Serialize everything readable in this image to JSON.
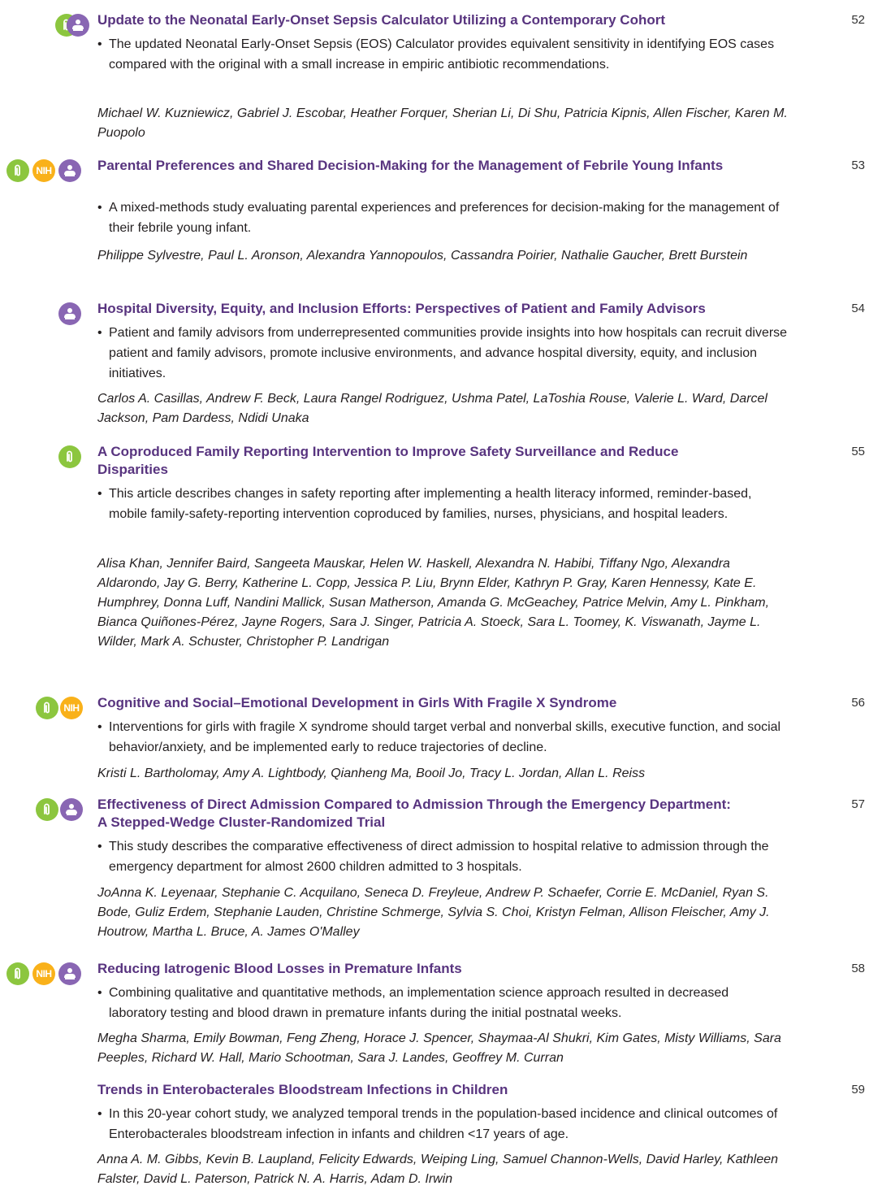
{
  "colors": {
    "title": "#58347f",
    "open_access_icon": "#8cc63f",
    "nih_icon": "#f9b11a",
    "family_icon": "#8966b3"
  },
  "entries": [
    {
      "icons": [
        "open-access",
        "family"
      ],
      "title": "Update to the Neonatal Early-Onset Sepsis Calculator Utilizing a Contemporary Cohort",
      "page": "52",
      "summary": "The updated Neonatal Early-Onset Sepsis (EOS) Calculator provides equivalent sensitivity in identifying EOS cases compared with the original with a small increase in empiric antibiotic recommendations.",
      "authors": "Michael W. Kuzniewicz, Gabriel J. Escobar, Heather Forquer, Sherian Li, Di Shu, Patricia Kipnis, Allen Fischer, Karen M. Puopolo"
    },
    {
      "icons": [
        "open-access",
        "nih",
        "family"
      ],
      "title": "Parental Preferences and Shared Decision-Making for the Management of Febrile Young Infants",
      "page": "53",
      "summary": "A mixed-methods study evaluating parental experiences and preferences for decision-making for the management of their febrile young infant.",
      "authors": "Philippe Sylvestre, Paul L. Aronson, Alexandra Yannopoulos, Cassandra Poirier, Nathalie Gaucher, Brett Burstein"
    },
    {
      "icons": [
        "family"
      ],
      "title": "Hospital Diversity, Equity, and Inclusion Efforts: Perspectives of Patient and Family Advisors",
      "page": "54",
      "summary": "Patient and family advisors from underrepresented communities provide insights into how hospitals can recruit diverse patient and family advisors, promote inclusive environments, and advance hospital diversity, equity, and inclusion initiatives.",
      "authors": "Carlos A. Casillas, Andrew F. Beck, Laura Rangel Rodriguez, Ushma Patel, LaToshia Rouse, Valerie L. Ward, Darcel Jackson, Pam Dardess, Ndidi Unaka"
    },
    {
      "icons": [
        "open-access"
      ],
      "title": "A Coproduced Family Reporting Intervention to Improve Safety Surveillance and Reduce Disparities",
      "page": "55",
      "summary": "This article describes changes in safety reporting after implementing a health literacy informed, reminder-based, mobile family-safety-reporting intervention coproduced by families, nurses, physicians, and hospital leaders.",
      "authors": "Alisa Khan, Jennifer Baird, Sangeeta Mauskar, Helen W. Haskell, Alexandra N. Habibi, Tiffany Ngo, Alexandra Aldarondo, Jay G. Berry, Katherine L. Copp, Jessica P. Liu, Brynn Elder, Kathryn P. Gray, Karen Hennessy, Kate E. Humphrey, Donna Luff, Nandini Mallick, Susan Matherson, Amanda G. McGeachey, Patrice Melvin, Amy L. Pinkham, Bianca Quiñones-Pérez, Jayne Rogers, Sara J. Singer, Patricia A. Stoeck, Sara L. Toomey, K. Viswanath, Jayme L. Wilder, Mark A. Schuster, Christopher P. Landrigan"
    },
    {
      "icons": [
        "open-access",
        "nih"
      ],
      "title": "Cognitive and Social–Emotional Development in Girls With Fragile X Syndrome",
      "page": "56",
      "summary": "Interventions for girls with fragile X syndrome should target verbal and nonverbal skills, executive function, and social behavior/anxiety, and be implemented early to reduce trajectories of decline.",
      "authors": "Kristi L. Bartholomay, Amy A. Lightbody, Qianheng Ma, Booil Jo, Tracy L. Jordan, Allan L. Reiss"
    },
    {
      "icons": [
        "open-access",
        "family"
      ],
      "title": "Effectiveness of Direct Admission Compared to Admission Through the Emergency Department: A Stepped-Wedge Cluster-Randomized Trial",
      "page": "57",
      "summary": "This study describes the comparative effectiveness of direct admission to hospital relative to admission through the emergency department for almost 2600 children admitted to 3 hospitals.",
      "authors": "JoAnna K. Leyenaar, Stephanie C. Acquilano, Seneca D. Freyleue, Andrew P. Schaefer, Corrie E. McDaniel, Ryan S. Bode, Guliz Erdem, Stephanie Lauden, Christine Schmerge, Sylvia S. Choi, Kristyn Felman, Allison Fleischer, Amy J. Houtrow, Martha L. Bruce, A. James O'Malley"
    },
    {
      "icons": [
        "open-access",
        "nih",
        "family"
      ],
      "title": "Reducing Iatrogenic Blood Losses in Premature Infants",
      "page": "58",
      "summary": "Combining qualitative and quantitative methods, an implementation science approach resulted in decreased laboratory testing and blood drawn in premature infants during the initial postnatal weeks.",
      "authors": "Megha Sharma, Emily Bowman, Feng Zheng, Horace J. Spencer, Shaymaa-Al Shukri, Kim Gates, Misty Williams, Sara Peeples, Richard W. Hall, Mario Schootman, Sara J. Landes, Geoffrey M. Curran"
    },
    {
      "icons": [],
      "title": "Trends in Enterobacterales Bloodstream Infections in Children",
      "page": "59",
      "summary": "In this 20-year cohort study, we analyzed temporal trends in the population-based incidence and clinical outcomes of Enterobacterales bloodstream infection in infants and children <17 years of age.",
      "authors": "Anna A. M. Gibbs, Kevin B. Laupland, Felicity Edwards, Weiping Ling, Samuel Channon-Wells, David Harley, Kathleen Falster, David L. Paterson, Patrick N. A. Harris, Adam D. Irwin"
    }
  ]
}
